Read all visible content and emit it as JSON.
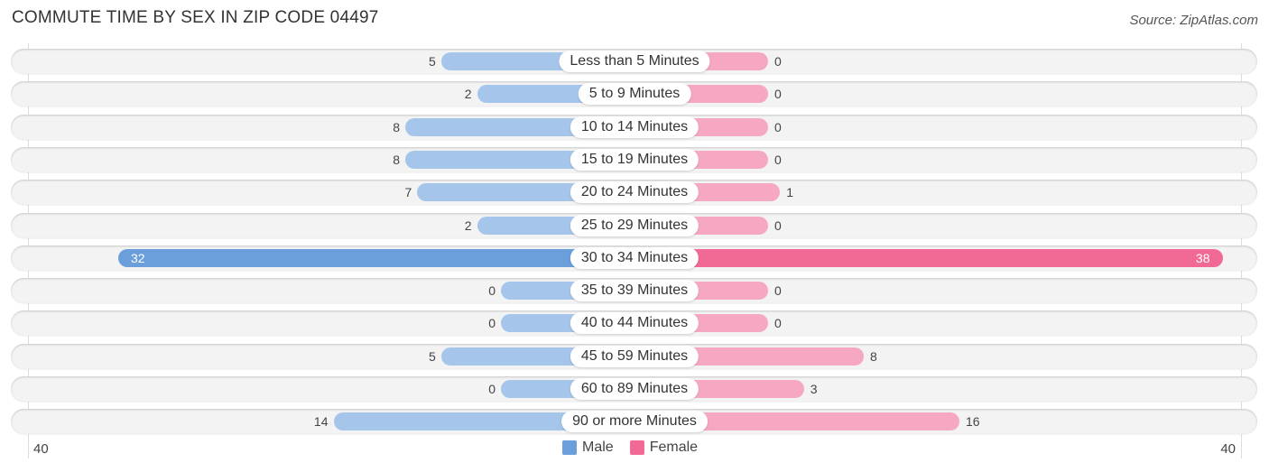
{
  "chart_data": {
    "type": "bar",
    "orientation": "horizontal-diverging",
    "title": "COMMUTE TIME BY SEX IN ZIP CODE 04497",
    "source": "Source: ZipAtlas.com",
    "categories": [
      "Less than 5 Minutes",
      "5 to 9 Minutes",
      "10 to 14 Minutes",
      "15 to 19 Minutes",
      "20 to 24 Minutes",
      "25 to 29 Minutes",
      "30 to 34 Minutes",
      "35 to 39 Minutes",
      "40 to 44 Minutes",
      "45 to 59 Minutes",
      "60 to 89 Minutes",
      "90 or more Minutes"
    ],
    "series": [
      {
        "name": "Male",
        "color": "#6a9fdc",
        "light_color": "#a5c6ea",
        "values": [
          5,
          2,
          8,
          8,
          7,
          2,
          32,
          0,
          0,
          5,
          0,
          14
        ]
      },
      {
        "name": "Female",
        "color": "#f06a95",
        "light_color": "#f6a8c2",
        "values": [
          0,
          0,
          0,
          0,
          1,
          0,
          38,
          0,
          0,
          8,
          3,
          16
        ]
      }
    ],
    "axis": {
      "left_label": "40",
      "right_label": "40",
      "max": 40
    },
    "legend": {
      "position": "bottom-center",
      "items": [
        "Male",
        "Female"
      ]
    }
  }
}
